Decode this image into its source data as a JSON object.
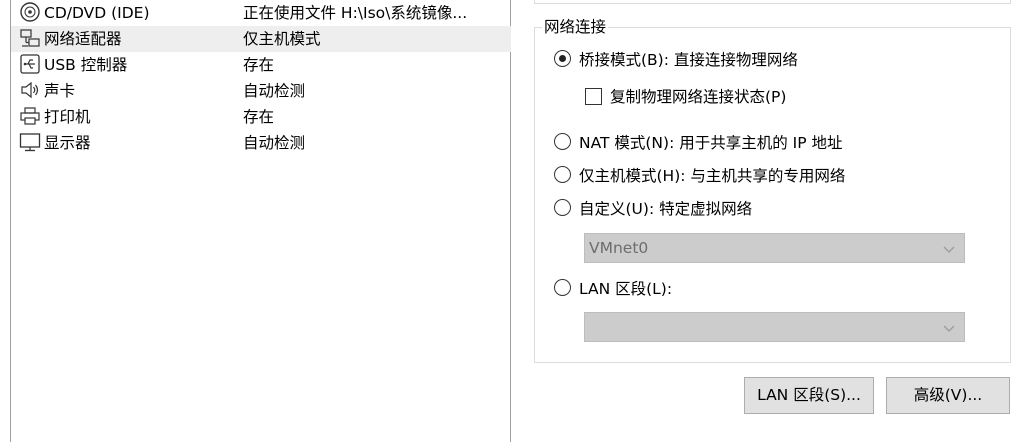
{
  "devices": [
    {
      "name": "CD/DVD (IDE)",
      "summary": "正在使用文件 H:\\Iso\\系统镜像...",
      "icon": "cd-dvd-icon"
    },
    {
      "name": "网络适配器",
      "summary": "仅主机模式",
      "icon": "network-adapter-icon",
      "selected": true
    },
    {
      "name": "USB 控制器",
      "summary": "存在",
      "icon": "usb-icon"
    },
    {
      "name": "声卡",
      "summary": "自动检测",
      "icon": "speaker-icon"
    },
    {
      "name": "打印机",
      "summary": "存在",
      "icon": "printer-icon"
    },
    {
      "name": "显示器",
      "summary": "自动检测",
      "icon": "monitor-icon"
    }
  ],
  "network": {
    "group_title": "网络连接",
    "bridged": {
      "label": "桥接模式(B): 直接连接物理网络",
      "checked": true
    },
    "replicate": {
      "label": "复制物理网络连接状态(P)",
      "checked": false
    },
    "nat": {
      "label": "NAT 模式(N): 用于共享主机的 IP 地址",
      "checked": false
    },
    "hostonly": {
      "label": "仅主机模式(H): 与主机共享的专用网络",
      "checked": false
    },
    "custom": {
      "label": "自定义(U): 特定虚拟网络",
      "checked": false
    },
    "custom_select_value": "VMnet0",
    "lan": {
      "label": "LAN 区段(L):",
      "checked": false
    },
    "lan_select_value": ""
  },
  "buttons": {
    "lan_segments": "LAN 区段(S)...",
    "advanced": "高级(V)..."
  },
  "colors": {
    "selected_row": "#eeeeee",
    "disabled_select": "#cccccc",
    "button_face": "#e1e1e1",
    "group_border": "#dcdcdc"
  }
}
